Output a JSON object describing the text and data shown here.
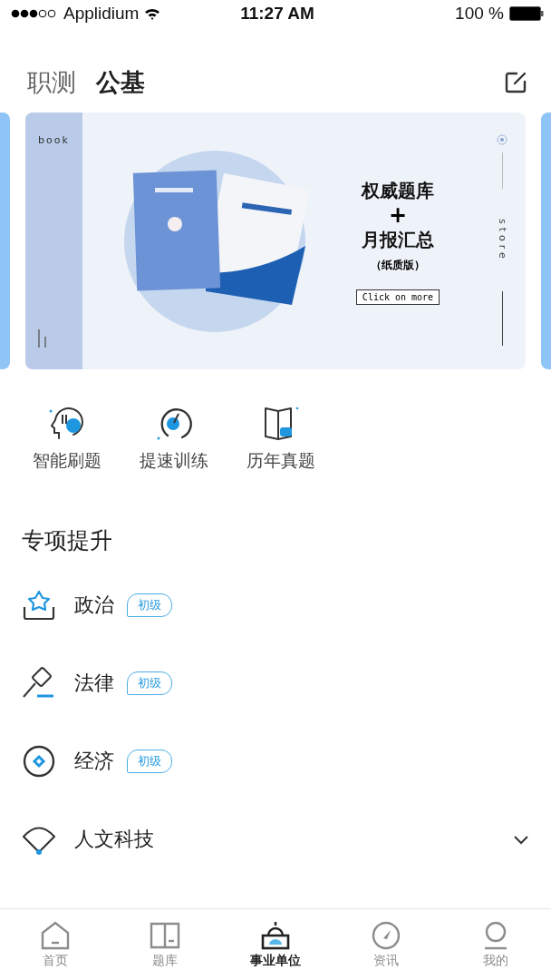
{
  "status_bar": {
    "carrier": "Applidium",
    "time": "11:27 AM",
    "battery": "100 %"
  },
  "header_tabs": [
    {
      "label": "职测",
      "selected": false
    },
    {
      "label": "公基",
      "selected": true
    }
  ],
  "banner": {
    "side_label": "book",
    "headline_1": "权威题库",
    "plus": "+",
    "headline_2": "月报汇总",
    "subtitle": "（纸质版）",
    "button": "Click on more",
    "vertical_label": "store"
  },
  "shortcuts": [
    {
      "kind": "ai",
      "label": "智能刷题"
    },
    {
      "kind": "speed",
      "label": "提速训练"
    },
    {
      "kind": "book",
      "label": "历年真题"
    }
  ],
  "section_title": "专项提升",
  "subjects": [
    {
      "kind": "politics",
      "name": "政治",
      "tag": "初级"
    },
    {
      "kind": "law",
      "name": "法律",
      "tag": "初级"
    },
    {
      "kind": "economy",
      "name": "经济",
      "tag": "初级"
    },
    {
      "kind": "culture",
      "name": "人文科技",
      "expanded": false
    }
  ],
  "bottom_tabs": [
    {
      "kind": "home",
      "label": "首页",
      "selected": false
    },
    {
      "kind": "bank",
      "label": "题库",
      "selected": false
    },
    {
      "kind": "unit",
      "label": "事业单位",
      "selected": true
    },
    {
      "kind": "news",
      "label": "资讯",
      "selected": false
    },
    {
      "kind": "me",
      "label": "我的",
      "selected": false
    }
  ]
}
